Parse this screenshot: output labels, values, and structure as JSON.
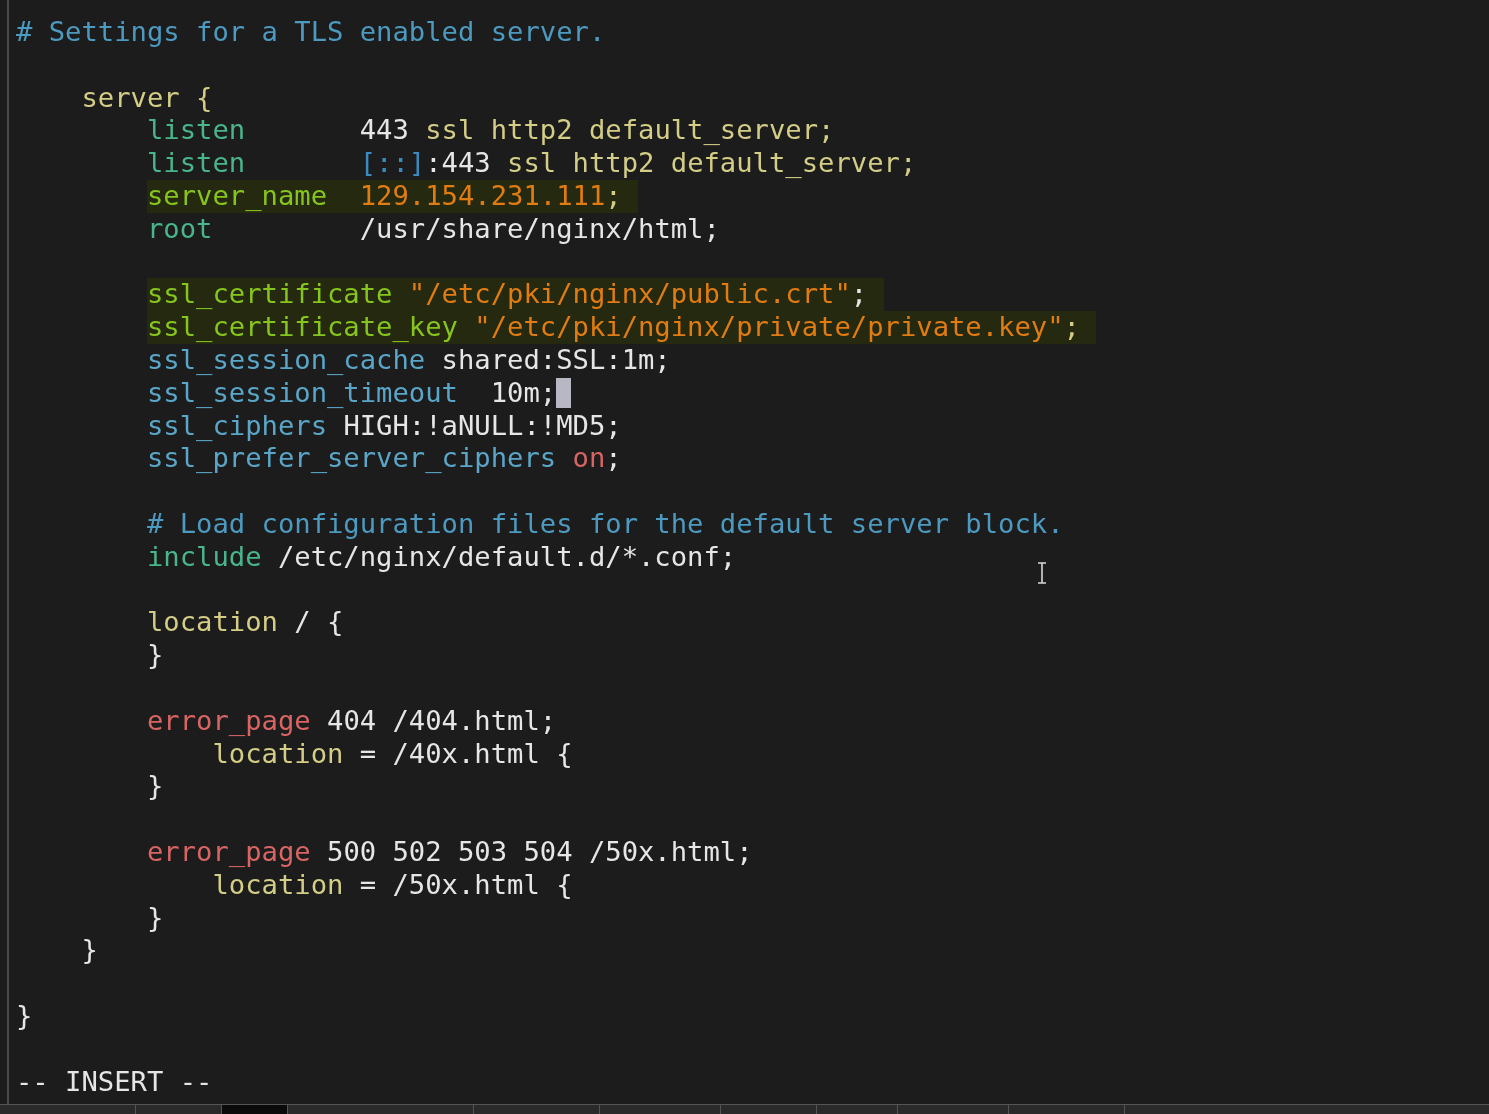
{
  "editor": {
    "blocks": [
      {
        "lines": [
          {
            "highlighted": false,
            "spans": [
              {
                "kind": "comment",
                "text": "# Settings for a TLS enabled server."
              }
            ]
          }
        ]
      },
      {
        "lines": [
          {
            "highlighted": false,
            "spans": [
              {
                "kind": "block",
                "text": "    server {"
              }
            ]
          },
          {
            "highlighted": false,
            "spans": [
              {
                "kind": "directive",
                "text": "        listen"
              },
              {
                "kind": "value",
                "text": "       443"
              },
              {
                "kind": "param",
                "text": " ssl http2 default_server;"
              }
            ]
          },
          {
            "highlighted": false,
            "spans": [
              {
                "kind": "directive",
                "text": "        listen"
              },
              {
                "kind": "address",
                "text": "       [::]"
              },
              {
                "kind": "value",
                "text": ":443"
              },
              {
                "kind": "param",
                "text": " ssl http2 default_server;"
              }
            ]
          },
          {
            "highlighted": true,
            "spans": [
              {
                "kind": "key",
                "text": "        server_name"
              },
              {
                "kind": "literal",
                "text": "  129.154.231.111"
              },
              {
                "kind": "param",
                "text": ";"
              }
            ]
          },
          {
            "highlighted": false,
            "spans": [
              {
                "kind": "directive",
                "text": "        root"
              },
              {
                "kind": "value",
                "text": "         /usr/share/nginx/html;"
              }
            ]
          }
        ]
      },
      {
        "lines": [
          {
            "highlighted": true,
            "spans": [
              {
                "kind": "key",
                "text": "        ssl_certificate"
              },
              {
                "kind": "literal",
                "text": " \"/etc/pki/nginx/public.crt\""
              },
              {
                "kind": "value",
                "text": ";"
              }
            ]
          },
          {
            "highlighted": true,
            "spans": [
              {
                "kind": "key",
                "text": "        ssl_certificate_key"
              },
              {
                "kind": "literal",
                "text": " \"/etc/pki/nginx/private/private.key\""
              },
              {
                "kind": "param",
                "text": ";"
              }
            ]
          },
          {
            "highlighted": false,
            "spans": [
              {
                "kind": "ssl",
                "text": "        ssl_session_cache"
              },
              {
                "kind": "value",
                "text": " shared:SSL:1m;"
              }
            ]
          },
          {
            "highlighted": false,
            "cursor": true,
            "spans": [
              {
                "kind": "ssl",
                "text": "        ssl_session_timeout"
              },
              {
                "kind": "value",
                "text": "  10m;"
              }
            ]
          },
          {
            "highlighted": false,
            "spans": [
              {
                "kind": "ssl",
                "text": "        ssl_ciphers"
              },
              {
                "kind": "value",
                "text": " HIGH:!aNULL:!MD5;"
              }
            ]
          },
          {
            "highlighted": false,
            "spans": [
              {
                "kind": "ssl",
                "text": "        ssl_prefer_server_ciphers"
              },
              {
                "kind": "flag",
                "text": " on"
              },
              {
                "kind": "value",
                "text": ";"
              }
            ]
          }
        ]
      },
      {
        "lines": [
          {
            "highlighted": false,
            "spans": [
              {
                "kind": "comment",
                "text": "        # Load configuration files for the default server block."
              }
            ]
          },
          {
            "highlighted": false,
            "spans": [
              {
                "kind": "directive",
                "text": "        include"
              },
              {
                "kind": "value",
                "text": " /etc/nginx/default.d/*.conf;"
              }
            ]
          }
        ]
      },
      {
        "lines": [
          {
            "highlighted": false,
            "spans": [
              {
                "kind": "block",
                "text": "        location"
              },
              {
                "kind": "value",
                "text": " / {"
              }
            ]
          },
          {
            "highlighted": false,
            "spans": [
              {
                "kind": "value",
                "text": "        }"
              }
            ]
          }
        ]
      },
      {
        "lines": [
          {
            "highlighted": false,
            "spans": [
              {
                "kind": "flag",
                "text": "        error_page"
              },
              {
                "kind": "value",
                "text": " 404 /404.html;"
              }
            ]
          },
          {
            "highlighted": false,
            "spans": [
              {
                "kind": "block",
                "text": "            location"
              },
              {
                "kind": "value",
                "text": " = /40x.html {"
              }
            ]
          },
          {
            "highlighted": false,
            "spans": [
              {
                "kind": "value",
                "text": "        }"
              }
            ]
          }
        ]
      },
      {
        "lines": [
          {
            "highlighted": false,
            "spans": [
              {
                "kind": "flag",
                "text": "        error_page"
              },
              {
                "kind": "value",
                "text": " 500 502 503 504 /50x.html;"
              }
            ]
          },
          {
            "highlighted": false,
            "spans": [
              {
                "kind": "block",
                "text": "            location"
              },
              {
                "kind": "value",
                "text": " = /50x.html {"
              }
            ]
          },
          {
            "highlighted": false,
            "spans": [
              {
                "kind": "value",
                "text": "        }"
              }
            ]
          },
          {
            "highlighted": false,
            "spans": [
              {
                "kind": "value",
                "text": "    }"
              }
            ]
          }
        ]
      },
      {
        "lines": [
          {
            "highlighted": false,
            "spans": [
              {
                "kind": "value",
                "text": "}"
              }
            ]
          }
        ]
      }
    ]
  },
  "status_line": {
    "mode": "-- INSERT --"
  }
}
